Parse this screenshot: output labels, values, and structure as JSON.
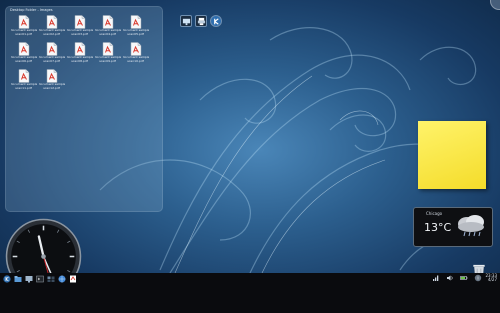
{
  "folder_view": {
    "title": "Desktop Folder - Images",
    "files": [
      {
        "label": "document sample",
        "label2": "scan01.pdf",
        "icon": "pdf-file-icon"
      },
      {
        "label": "document sample",
        "label2": "scan02.pdf",
        "icon": "pdf-file-icon"
      },
      {
        "label": "document sample",
        "label2": "scan03.pdf",
        "icon": "pdf-file-icon"
      },
      {
        "label": "document sample",
        "label2": "scan04.pdf",
        "icon": "pdf-file-icon"
      },
      {
        "label": "document sample",
        "label2": "scan05.pdf",
        "icon": "pdf-file-icon"
      },
      {
        "label": "document sample",
        "label2": "scan06.pdf",
        "icon": "pdf-file-icon"
      },
      {
        "label": "document sample",
        "label2": "scan07.pdf",
        "icon": "pdf-file-icon"
      },
      {
        "label": "document sample",
        "label2": "scan08.pdf",
        "icon": "pdf-file-icon"
      },
      {
        "label": "document sample",
        "label2": "scan09.pdf",
        "icon": "pdf-file-icon"
      },
      {
        "label": "document sample",
        "label2": "scan10.pdf",
        "icon": "pdf-file-icon"
      },
      {
        "label": "document sample",
        "label2": "scan11.pdf",
        "icon": "pdf-file-icon"
      },
      {
        "label": "document sample",
        "label2": "scan12.pdf",
        "icon": "pdf-file-icon"
      }
    ]
  },
  "top_icons": [
    "monitor-icon",
    "printer-icon",
    "kde-icon"
  ],
  "weather": {
    "city": "Chicago",
    "temperature": "13°C",
    "icon": "rain-cloud-icon"
  },
  "taskbar": {
    "launchers": [
      "kde-menu-icon",
      "file-manager-icon",
      "desktop-icon",
      "terminal-icon",
      "pager-icon",
      "browser-icon",
      "pdf-viewer-icon"
    ],
    "tray": [
      "network-icon",
      "volume-icon",
      "battery-icon",
      "notifications-icon"
    ],
    "time": "23:33",
    "date": "4/27"
  },
  "colors": {
    "accent": "#4a86b8",
    "note": "#f4dc2a",
    "pdf": "#d9372b"
  }
}
